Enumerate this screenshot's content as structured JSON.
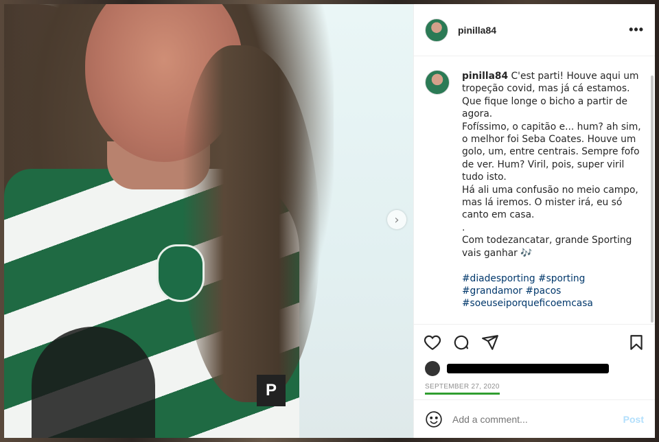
{
  "post": {
    "username": "pinilla84",
    "more_label": "•••",
    "next_label": "›",
    "jersey_badge": "P",
    "caption_lines": [
      "C'est parti! Houve aqui um",
      "tropeção covid, mas já cá estamos.",
      "Que fique longe o bicho a partir de",
      "agora.",
      "Fofíssimo, o capitão e... hum? ah sim,",
      "o melhor foi Seba Coates. Houve um",
      "golo, um, entre centrais. Sempre fofo",
      "de ver. Hum? Viril, pois, super viril",
      "tudo isto.",
      "Há ali uma confusão no meio campo,",
      "mas lá iremos. O mister irá, eu só",
      "canto em casa.",
      ".",
      "Com todezancatar, grande Sporting",
      "vais ganhar 🎶"
    ],
    "hashtags_lines": [
      "#diadesporting #sporting",
      "#grandamor #pacos",
      "#soeuseiporqueficoemcasa"
    ],
    "date": "SEPTEMBER 27, 2020",
    "comment_placeholder": "Add a comment...",
    "post_label": "Post"
  },
  "colors": {
    "link": "#00376b",
    "post_disabled": "#b2dffc",
    "date_underline": "#2f9e2f"
  },
  "icons": [
    "heart-icon",
    "comment-icon",
    "share-icon",
    "bookmark-icon",
    "emoji-icon",
    "more-icon",
    "next-arrow-icon"
  ]
}
